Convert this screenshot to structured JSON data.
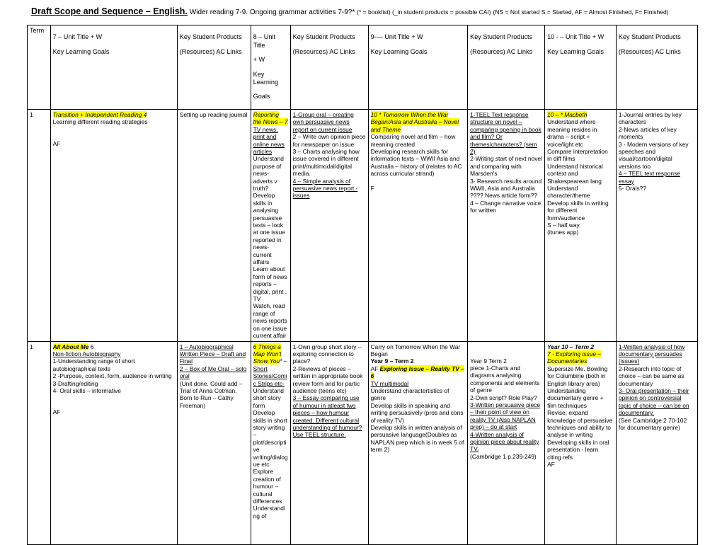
{
  "title": {
    "main": "Draft Scope and Sequence – English.",
    "sub": "Wider reading 7-9.   Ongoing grammar activities 7-9?*",
    "note": "(* = booklist)  (_in student products = possible CAI)",
    "key": "(NS = Not started S = Started, AF = Almost Finished, F= Finished)"
  },
  "table": {
    "headers": {
      "term": "Term",
      "y7_unit": "7 – Unit Title + W\nKey Learning Goals",
      "y7_products": "Key Student Products (Resources) AC  Links",
      "y8_unit": "8 – Unit Title + W\nKey Learning Goals",
      "y8_products": "Key Student Products (Resources) AC  Links",
      "y9_unit": "9-— Unit Title + W\nKey Learning Goals",
      "y9_products": "Key Student Products (Resources) AC  Links",
      "y10_unit": "10 - – Unit Title + W\nKey Learning Goals",
      "y10_products": "Key Student Products (Resources) AC  Links"
    },
    "rows": [
      {
        "term": "1",
        "y7_unit": {
          "heading": "Transition + Independent Reading 4",
          "lines": [
            "Learning different reading strategies"
          ],
          "status": "AF"
        },
        "y7_products": {
          "lines": [
            "Setting up reading journal"
          ]
        },
        "y8_unit": {
          "heading": "Reporting the News – 7",
          "underlined": "TV news, print and online news articles",
          "lines": [
            "Understand purpose of news- adverts v truth?",
            "Develop skills in analysing persuasive texts – look at one issue reported in news- current affairs",
            "Learn about form of news reports – digital, print , TV",
            "Watch, read range of news reports on one issue current affair"
          ]
        },
        "y8_products": {
          "items": [
            "1-Group oral – creating own persuasive news report on current issue",
            "2 – Write own opinion piece for newspaper on issue",
            "3 – Charts analysing how issue covered in different print/multimodal/digital media.",
            "4 – Simple analysis of persuasive news report - issues"
          ]
        },
        "y9_unit": {
          "heading": "10 * Tomorrow When the War Began/Asia and Australia – Novel and Theme",
          "lines": [
            "Comparing novel and film – how meaning created",
            "Developing research skills for information texts – WWII Asia and Australia – history of (relates to AC across curricular strand)"
          ],
          "status": "F"
        },
        "y9_products": {
          "items": [
            "1-TEEL Text response structure on novel – comparing opening in book and film? Or themes/characters? (sem 2)",
            "2-Writing start of next novel and comparing with Marsden's",
            "3- Research results around WWII, Asia and Australia ???? News article form??",
            "4 – Change narrative voice for written"
          ]
        },
        "y10_unit": {
          "heading": "10 – * Macbeth",
          "lines": [
            "Understand where meaning resides in drama – script + voice/light etc",
            "Compare interpretation in diff films",
            "Understand historical context and Shakespearean lang",
            "Understand character/theme",
            "Develop skills in writing for different form/audience"
          ],
          "status": "S – half way",
          "extra": "(itunes app)"
        },
        "y10_products": {
          "items": [
            "1-Journal entries by key characters",
            "2-News articles of key moments",
            "3  - Modern versions of key speeches and visual/cartoon/digital versions too",
            "4 – TEEL text response essay",
            "5- Orals??"
          ]
        }
      },
      {
        "term": "1",
        "y7_unit": {
          "heading": "All About Me",
          "heading_suffix": " 6",
          "underlined": "Non-fiction Autobiography",
          "lines": [
            "1-Understanding range of short autobiographical texts",
            "2 -Purpose, context, form, audience in writing",
            "3-Drafting/editing",
            "4- Oral skills – informative"
          ],
          "status": "AF"
        },
        "y7_products": {
          "items": [
            "1 – Autobiographical Written Piece – Draft and Final",
            "2 – Box of Me Oral – solo oral",
            "(Unit done.  Could add – Trial of Anna Cotman, Born to Run – Cathy Freeman)"
          ]
        },
        "y8_unit": {
          "heading": "6 Things a Map Won't Show You",
          "heading_suffix": "* –",
          "underlined": "Short Stories/Comic Strips etc-",
          "lines": [
            "Understand short story form",
            "Develop skills in short story writing – plot/descriptive writing/dialogue etc",
            "Explore creation of humour – cultural differences",
            "Understanding of"
          ]
        },
        "y8_products": {
          "items": [
            "1-Own group short story – exploring connection to place?",
            "2-Reviews of pieces – written in appropriate book review form and for partic audience (teens etc)",
            "3 – Essay comparing use of humour in atleast two pieces – how humour created.  Different cultural understanding of humour? Use TEEL structure."
          ]
        },
        "y9_unit": {
          "pre_lines": [
            "Carry on Tomorrow When the War Began"
          ],
          "bold_line": "Year 9 – Term 2",
          "status_prefix": "AF ",
          "heading": "Exploring Issue – Reality TV – 6",
          "underlined": "TV  multimodal",
          "lines": [
            "Understand charactertistics of genre",
            "Develop skills in speaking and writing persuasively (pros and cons of reality TV)",
            "Develop skills in written analysis of persuasive language(Doubles as NAPLAN prep which is in week 5 of term 2)"
          ]
        },
        "y9_products": {
          "lines": [
            "Year 9 Term 2",
            "piece 1-Charts and diagrams analysing components and elements of genre",
            "2-Own script? Role Play?"
          ],
          "items": [
            "3-Written persuasive piece – their point of view on reality TV (Also NAPLAN prep) – do at start",
            "4-Written analysis of opinion piece about reality TV. "
          ],
          "note": "(Cambridge 1 p.239-249)"
        },
        "y10_unit": {
          "bold_line": "Year 10 – Term 2",
          "heading": "7 - Exploring issue – Documentaries",
          "lines": [
            "Supersize Me. Bowling for Columbine (both in English library area)",
            " Understanding documentary genre + film techniques",
            "Revise, expand knowledge of persuasive techniques and ability to analyse in writing",
            "Developing skills in oral presentation  - learn citing refs"
          ],
          "status": "AF"
        },
        "y10_products": {
          "items": [
            "1-Written analysis of how documentary persuades (issues)",
            "2-Research into topic of choice – can be same as documentary",
            "3- Oral presentation – their opinion on controversial topic of choice – can be on documentary.",
            "(See Cambridge 2 70-102 for documentary genre)"
          ]
        }
      }
    ]
  },
  "colors": {
    "highlight": "#ffff00",
    "border": "#000000",
    "text": "#000000"
  }
}
